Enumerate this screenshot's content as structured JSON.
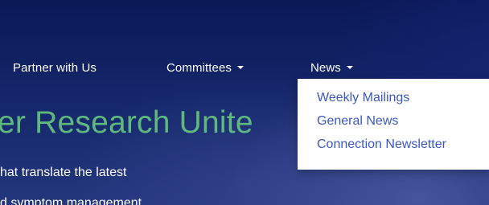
{
  "nav": {
    "partner_label": "Partner with Us",
    "committees_label": "Committees",
    "news_label": "News"
  },
  "hero": {
    "title": "er Research Unite",
    "subtitle_line1": "hat translate the latest",
    "subtitle_line2": "d symptom management"
  },
  "news_dropdown": {
    "items": [
      {
        "label": "Weekly Mailings"
      },
      {
        "label": "General News"
      },
      {
        "label": "Connection Newsletter"
      }
    ]
  },
  "colors": {
    "background": "#142669",
    "title_green": "#5fb87e",
    "dropdown_link": "#3b57c3",
    "nav_text": "#ffffff"
  }
}
